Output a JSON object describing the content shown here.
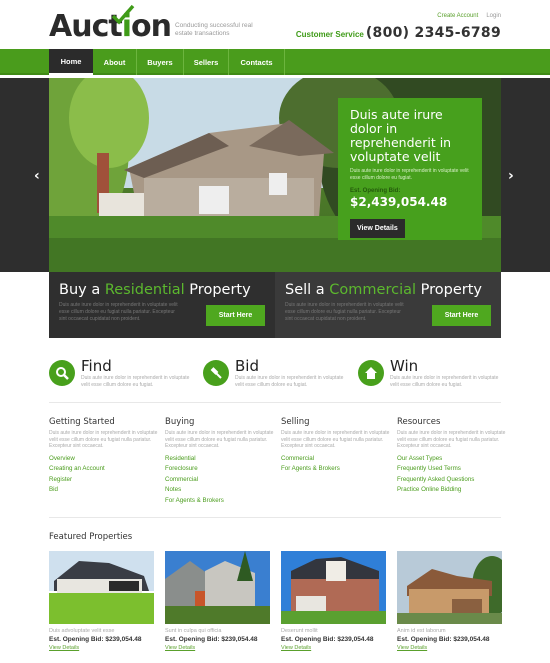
{
  "header": {
    "logo_main": "Auct",
    "logo_i": "i",
    "logo_end": "on",
    "tagline": "Conducting successful real estate transactions",
    "top_links": [
      "Create Account",
      "Login"
    ],
    "customer_service_label": "Customer Service",
    "phone": "(800) 2345-6789"
  },
  "nav": {
    "items": [
      {
        "label": "Home",
        "active": true
      },
      {
        "label": "About"
      },
      {
        "label": "Buyers"
      },
      {
        "label": "Sellers"
      },
      {
        "label": "Contacts"
      }
    ]
  },
  "hero": {
    "prev_arrow": "‹",
    "next_arrow": "›",
    "promo_title": "Duis aute irure dolor in reprehenderit in voluptate velit",
    "promo_text": "Duis aute irure dolor in reprehenderit in voluptate velit esse cillum dolore eu fugiat.",
    "bid_label": "Est. Opening Bid:",
    "bid_value": "$2,439,054.48",
    "button": "View Details"
  },
  "cta": [
    {
      "pre": "Buy a ",
      "highlight": "Residential",
      "post": " Property",
      "text": "Duis aute irure dolor in reprehenderit in voluptate velit esse cillum dolore eu fugiat nulla pariatur. Excepteur sint occaecat cupidatat non proident.",
      "button": "Start Here"
    },
    {
      "pre": "Sell a ",
      "highlight": "Commercial",
      "post": " Property",
      "text": "Duis aute irure dolor in reprehenderit in voluptate velit esse cillum dolore eu fugiat nulla pariatur. Excepteur sint occaecat cupidatat non proident.",
      "button": "Start Here"
    }
  ],
  "features": [
    {
      "icon": "search-icon",
      "title": "Find",
      "text": "Duis aute irure dolor in reprehenderit in voluptate velit esse cillum dolore eu fugiat."
    },
    {
      "icon": "gavel-icon",
      "title": "Bid",
      "text": "Duis aute irure dolor in reprehenderit in voluptate velit esse cillum dolore eu fugiat."
    },
    {
      "icon": "home-icon",
      "title": "Win",
      "text": "Duis aute irure dolor in reprehenderit in voluptate velit esse cillum dolore eu fugiat."
    }
  ],
  "columns": [
    {
      "title": "Getting Started",
      "text": "Duis aute irure dolor in reprehenderit in voluptate velit esse cillum dolore eu fugiat nulla pariatur. Excepteur sint occaecat.",
      "links": [
        "Overview",
        "Creating an Account",
        "Register",
        "Bid"
      ]
    },
    {
      "title": "Buying",
      "text": "Duis aute irure dolor in reprehenderit in voluptate velit esse cillum dolore eu fugiat nulla pariatur. Excepteur sint occaecat.",
      "links": [
        "Residential",
        "Foreclosure",
        "Commercial",
        "Notes",
        "For Agents & Brokers"
      ]
    },
    {
      "title": "Selling",
      "text": "Duis aute irure dolor in reprehenderit in voluptate velit esse cillum dolore eu fugiat nulla pariatur. Excepteur sint occaecat.",
      "links": [
        "Commercial",
        "For Agents & Brokers"
      ]
    },
    {
      "title": "Resources",
      "text": "Duis aute irure dolor in reprehenderit in voluptate velit esse cillum dolore eu fugiat nulla pariatur. Excepteur sint occaecat.",
      "links": [
        "Our Asset Types",
        "Frequently Used Terms",
        "Frequently Asked Questions",
        "Practice Online Bidding"
      ]
    }
  ],
  "featured": {
    "title": "Featured Properties",
    "cards": [
      {
        "caption": "Duis advoluptate velit esse",
        "price": "Est. Opening Bid: $239,054.48",
        "link": "View Details"
      },
      {
        "caption": "Sunt in culpa qui officia",
        "price": "Est. Opening Bid: $239,054.48",
        "link": "View Details"
      },
      {
        "caption": "Deserunt mollit",
        "price": "Est. Opening Bid: $239,054.48",
        "link": "View Details"
      },
      {
        "caption": "Anim id est laborum",
        "price": "Est. Opening Bid: $239,054.48",
        "link": "View Details"
      }
    ]
  },
  "colors": {
    "brand_green": "#4a9c1c",
    "dark": "#2b2b2b",
    "cta_green": "#4fa81f"
  }
}
